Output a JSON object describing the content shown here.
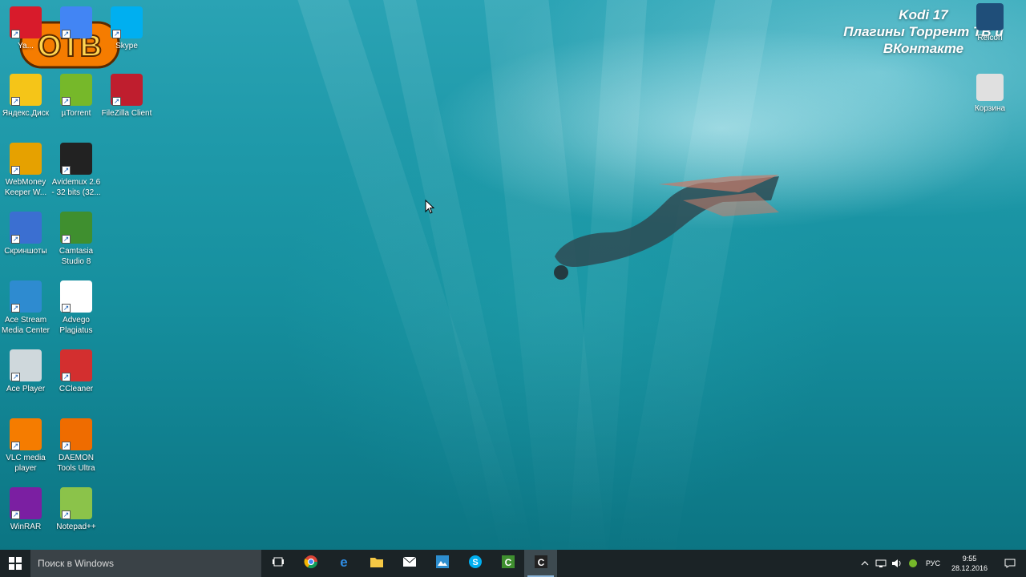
{
  "overlay": {
    "channel_logo": "OTB",
    "kodi_line1": "Kodi 17",
    "kodi_line2": "Плагины Торрент TB и",
    "kodi_line3": "ВКонтакте"
  },
  "desktop_icons": [
    {
      "label": "Ya...",
      "icon": "yandex-browser-icon",
      "color": "#d81b2b"
    },
    {
      "label": "",
      "icon": "chrome-icon",
      "color": "#4285f4"
    },
    {
      "label": "Skype",
      "icon": "skype-icon",
      "color": "#00aff0"
    },
    {
      "label": "Яндекс.Диск",
      "icon": "yandex-disk-icon",
      "color": "#f5c518"
    },
    {
      "label": "µTorrent",
      "icon": "utorrent-icon",
      "color": "#76b82a"
    },
    {
      "label": "FileZilla Client",
      "icon": "filezilla-icon",
      "color": "#bf1e2e"
    },
    {
      "label": "WebMoney Keeper W...",
      "icon": "webmoney-icon",
      "color": "#e6a100"
    },
    {
      "label": "Avidemux 2.6 - 32 bits (32...",
      "icon": "clapperboard-icon",
      "color": "#222222"
    },
    {
      "label": "Скриншоты",
      "icon": "screenshot-scissors-icon",
      "color": "#3b6fd1"
    },
    {
      "label": "Camtasia Studio 8",
      "icon": "camtasia-icon",
      "color": "#3f8f2f"
    },
    {
      "label": "Ace Stream Media Center",
      "icon": "ace-stream-icon",
      "color": "#2e8bd0"
    },
    {
      "label": "Advego Plagiatus",
      "icon": "advego-icon",
      "color": "#ffffff"
    },
    {
      "label": "Ace Player",
      "icon": "ace-player-icon",
      "color": "#cfd8dc"
    },
    {
      "label": "CCleaner",
      "icon": "ccleaner-icon",
      "color": "#d32f2f"
    },
    {
      "label": "VLC media player",
      "icon": "vlc-cone-icon",
      "color": "#f57c00"
    },
    {
      "label": "DAEMON Tools Ultra",
      "icon": "daemon-tools-icon",
      "color": "#ef6c00"
    },
    {
      "label": "WinRAR",
      "icon": "winrar-icon",
      "color": "#7b1fa2"
    },
    {
      "label": "Notepad++",
      "icon": "notepadpp-icon",
      "color": "#8bc34a"
    }
  ],
  "right_icons": [
    {
      "label": "Relcon",
      "icon": "monitor-icon",
      "color": "#1f4e79"
    },
    {
      "label": "Корзина",
      "icon": "recycle-bin-icon",
      "color": "#e0e0e0"
    }
  ],
  "taskbar": {
    "search_placeholder": "Поиск в Windows",
    "pinned": [
      {
        "name": "task-view-icon",
        "active": false
      },
      {
        "name": "chrome-icon",
        "active": false
      },
      {
        "name": "edge-icon",
        "active": false
      },
      {
        "name": "file-explorer-icon",
        "active": false
      },
      {
        "name": "mail-icon",
        "active": false
      },
      {
        "name": "photo-app-icon",
        "active": false
      },
      {
        "name": "skype-icon",
        "active": false
      },
      {
        "name": "camtasia-icon",
        "active": false
      },
      {
        "name": "camtasia-recorder-icon",
        "active": true
      }
    ],
    "tray": {
      "language": "РУС",
      "time": "9:55",
      "date": "28.12.2016"
    }
  },
  "colors": {
    "taskbar": "#1b2326",
    "search_box": "#3a4247",
    "water": "#1d98a8"
  }
}
